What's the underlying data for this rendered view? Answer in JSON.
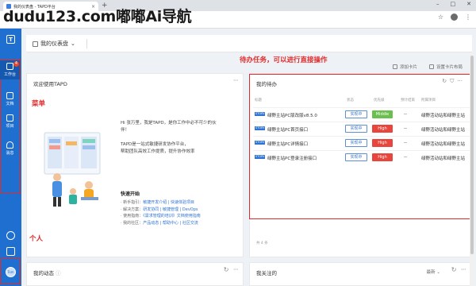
{
  "browser": {
    "tab_title": "我的仪表盘 - TAPD平台",
    "new_tab": "+",
    "window_controls": [
      "–",
      "□",
      "✕"
    ],
    "watermark": "dudu123.com嘟嘟Ai导航"
  },
  "nav": {
    "items": [
      {
        "label": "工作台",
        "icon": "workbench-icon",
        "badge": "4"
      },
      {
        "label": "文档",
        "icon": "document-icon"
      },
      {
        "label": "项目",
        "icon": "project-icon"
      },
      {
        "label": "消息",
        "icon": "bell-icon"
      }
    ],
    "avatar_text": "Tom"
  },
  "header": {
    "title": "我的仪表盘",
    "add_card": "添加卡片",
    "settings": "设置卡片布局"
  },
  "annotations": {
    "menu": "菜单",
    "personal": "个人",
    "todo": "待办任务，可以进行直接操作"
  },
  "welcome": {
    "title": "欢迎使用TAPD",
    "line1": "Hi 张万里，我是TAPD，是你工作中必不可少的伙",
    "line2": "伴！",
    "line3": "TAPD是一站式敏捷研发协作平台，",
    "line4": "帮助团队高效工作提质，提升协作效率",
    "quick_start": "快速开始",
    "qs": [
      {
        "label": "· 新手指引：",
        "links": "敏捷开发介绍 | 快速体验项目"
      },
      {
        "label": "· 解决方案：",
        "links": "研发协同 | 敏捷管理 | DevOps"
      },
      {
        "label": "· 使用指南：",
        "links": "《需求管理的培训》文档使用指南"
      },
      {
        "label": "· 我的社区：",
        "links": "产品动态 | 帮助中心 | 社区交流"
      }
    ]
  },
  "todo": {
    "title": "我的待办",
    "columns": [
      "标题",
      "状态",
      "优先级",
      "预计结束",
      "所属项目"
    ],
    "rows": [
      {
        "type": "STORY",
        "title": "绿野主站PC版改版v8.5.0",
        "status": "实现中",
        "priority": "Middle",
        "due": "--",
        "project": "绿野活动站和绿野主站"
      },
      {
        "type": "STORY",
        "title": "绿野主站PC首页接口",
        "status": "实现中",
        "priority": "High",
        "due": "--",
        "project": "绿野活动站和绿野主站"
      },
      {
        "type": "STORY",
        "title": "绿野主站PC详情接口",
        "status": "实现中",
        "priority": "High",
        "due": "--",
        "project": "绿野活动站和绿野主站"
      },
      {
        "type": "STORY",
        "title": "绿野主站PC登录注册接口",
        "status": "实现中",
        "priority": "High",
        "due": "--",
        "project": "绿野活动站和绿野主站"
      }
    ],
    "footer": "共 4 条"
  },
  "activity": {
    "title": "我的动态",
    "filter": "最新"
  },
  "followed": {
    "title": "我关注的"
  },
  "colors": {
    "nav": "#1f6fd1",
    "middle": "#6bbf4e",
    "high": "#e8453c",
    "annotation": "#e02b2b"
  }
}
